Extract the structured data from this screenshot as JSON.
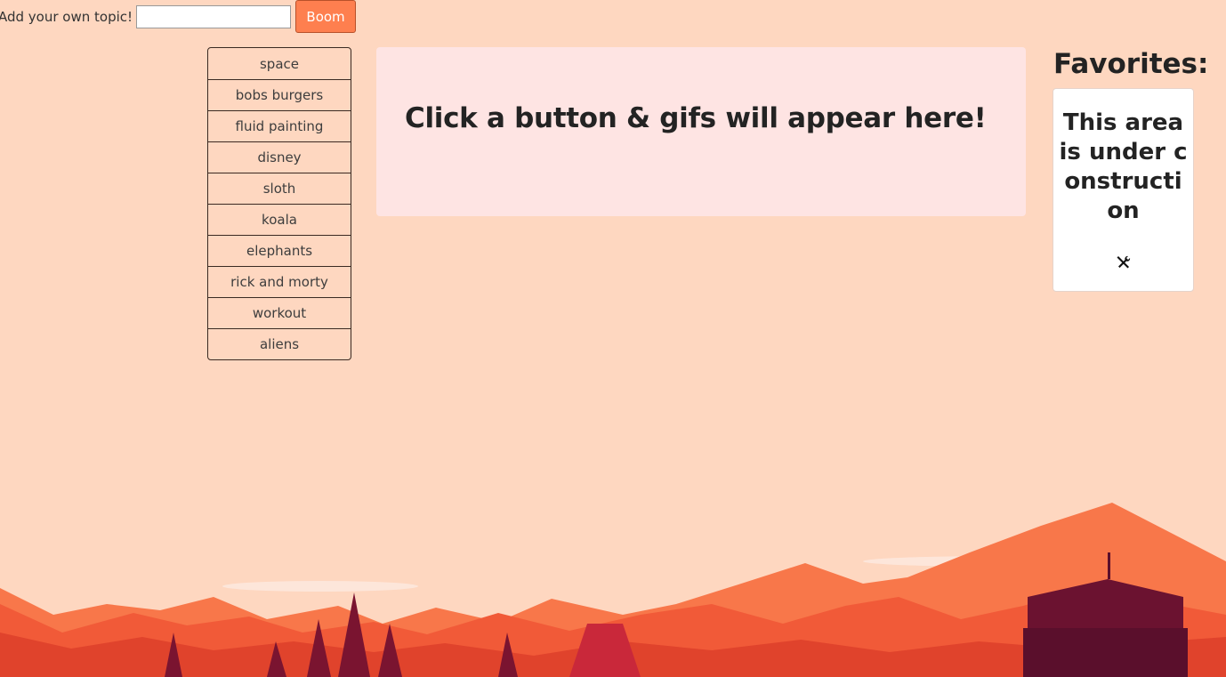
{
  "form": {
    "label": "Add your own topic!",
    "input_value": "",
    "input_placeholder": "",
    "submit_label": "Boom"
  },
  "topics": [
    "space",
    "bobs burgers",
    "fluid painting",
    "disney",
    "sloth",
    "koala",
    "elephants",
    "rick and morty",
    "workout",
    "aliens"
  ],
  "gif_area": {
    "message": "Click a button & gifs will appear here!"
  },
  "favorites": {
    "title": "Favorites:",
    "message": "This area is under construction",
    "icon": "tools-icon"
  },
  "colors": {
    "background": "#fed7c0",
    "accent": "#fe7f4f",
    "gif_panel": "#fee4e3"
  }
}
